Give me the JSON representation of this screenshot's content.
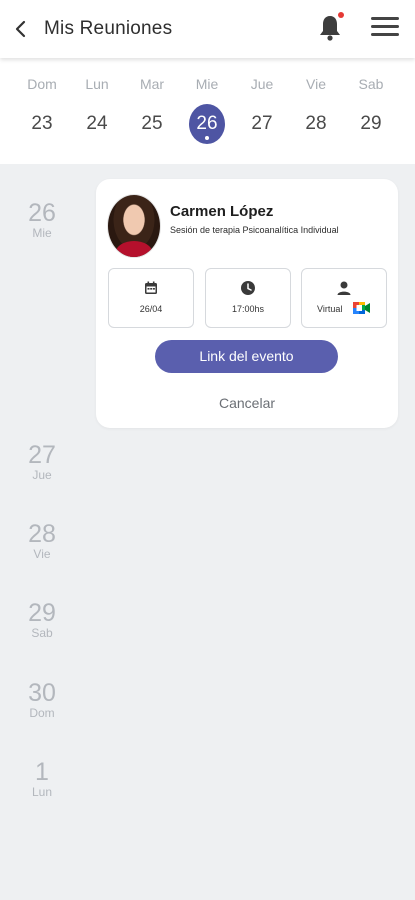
{
  "header": {
    "title": "Mis Reuniones",
    "has_notification": true
  },
  "week": {
    "days": [
      {
        "name": "Dom",
        "num": "23"
      },
      {
        "name": "Lun",
        "num": "24"
      },
      {
        "name": "Mar",
        "num": "25"
      },
      {
        "name": "Mie",
        "num": "26",
        "selected": true
      },
      {
        "name": "Jue",
        "num": "27"
      },
      {
        "name": "Vie",
        "num": "28"
      },
      {
        "name": "Sab",
        "num": "29"
      }
    ]
  },
  "agenda": [
    {
      "num": "26",
      "name": "Mie"
    },
    {
      "num": "27",
      "name": "Jue"
    },
    {
      "num": "28",
      "name": "Vie"
    },
    {
      "num": "29",
      "name": "Sab"
    },
    {
      "num": "30",
      "name": "Dom"
    },
    {
      "num": "1",
      "name": "Lun"
    }
  ],
  "event": {
    "person_name": "Carmen López",
    "session": "Sesión de terapia Psicoanalítica Individual",
    "date": "26/04",
    "time": "17:00hs",
    "mode": "Virtual",
    "link_label": "Link del evento",
    "cancel_label": "Cancelar"
  },
  "colors": {
    "accent": "#4e55a3",
    "button": "#5a5fae",
    "notification": "#e53935",
    "background": "#eef0f2"
  }
}
